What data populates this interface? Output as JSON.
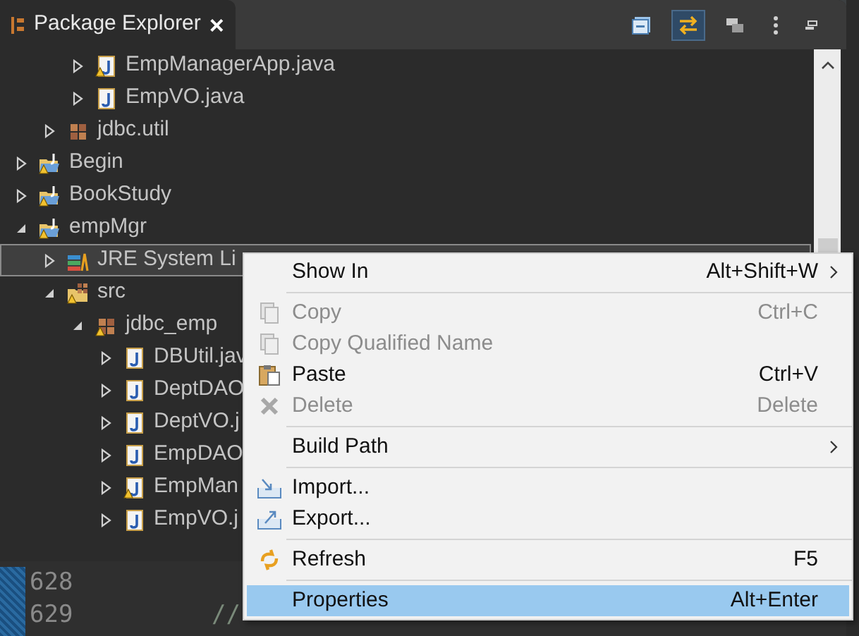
{
  "view_tab": {
    "title": "Package Explorer",
    "close": "×"
  },
  "toolbar": [
    {
      "selected": false
    },
    {
      "selected": true
    },
    {
      "selected": false
    },
    {
      "selected": false
    },
    {
      "selected": false
    }
  ],
  "tree": [
    {
      "children": [
        {
          "children": [
            {
              "kind": "java",
              "label": "EmpManagerApp.java",
              "warning": true,
              "expanded": false,
              "selected": false
            },
            {
              "kind": "java",
              "label": "EmpVO.java",
              "warning": false,
              "expanded": false,
              "selected": false
            }
          ]
        },
        {
          "kind": "package",
          "label": "jdbc.util",
          "warning": false,
          "expanded": false,
          "selected": false
        }
      ]
    },
    {
      "kind": "project",
      "label": "Begin",
      "warning": true,
      "expanded": false,
      "selected": false
    },
    {
      "kind": "project",
      "label": "BookStudy",
      "warning": true,
      "expanded": false,
      "selected": false
    },
    {
      "kind": "project",
      "label": "empMgr",
      "warning": true,
      "expanded": true,
      "selected": false,
      "children": [
        {
          "kind": "library",
          "label": "JRE System Li",
          "warning": false,
          "expanded": false,
          "selected": true
        },
        {
          "kind": "source",
          "label": "src",
          "warning": true,
          "expanded": true,
          "selected": false,
          "children": [
            {
              "kind": "package",
              "label": "jdbc_emp",
              "warning": true,
              "expanded": true,
              "selected": false,
              "children": [
                {
                  "kind": "java",
                  "label": "DBUtil.jav",
                  "warning": false,
                  "expanded": false,
                  "selected": false
                },
                {
                  "kind": "java",
                  "label": "DeptDAO",
                  "warning": false,
                  "expanded": false,
                  "selected": false
                },
                {
                  "kind": "java",
                  "label": "DeptVO.j",
                  "warning": false,
                  "expanded": false,
                  "selected": false
                },
                {
                  "kind": "java",
                  "label": "EmpDAO",
                  "warning": false,
                  "expanded": false,
                  "selected": false
                },
                {
                  "kind": "java",
                  "label": "EmpMan",
                  "warning": true,
                  "expanded": false,
                  "selected": false
                },
                {
                  "kind": "java",
                  "label": "EmpVO.j",
                  "warning": false,
                  "expanded": false,
                  "selected": false
                }
              ]
            }
          ]
        }
      ]
    }
  ],
  "editor": {
    "lines": [
      {
        "number": "628"
      },
      {
        "number": "629",
        "code": "//"
      }
    ]
  },
  "context_menu": [
    {
      "kind": "item",
      "label": "Show In",
      "shortcut": "Alt+Shift+W",
      "submenu": true,
      "disabled": false,
      "selected": false
    },
    {
      "kind": "separator"
    },
    {
      "kind": "item",
      "label": "Copy",
      "shortcut": "Ctrl+C",
      "submenu": false,
      "disabled": true,
      "selected": false
    },
    {
      "kind": "item",
      "label": "Copy Qualified Name",
      "submenu": false,
      "disabled": true,
      "selected": false
    },
    {
      "kind": "item",
      "label": "Paste",
      "shortcut": "Ctrl+V",
      "submenu": false,
      "disabled": false,
      "selected": false
    },
    {
      "kind": "item",
      "label": "Delete",
      "shortcut": "Delete",
      "submenu": false,
      "disabled": true,
      "selected": false
    },
    {
      "kind": "separator"
    },
    {
      "kind": "item",
      "label": "Build Path",
      "submenu": true,
      "disabled": false,
      "selected": false
    },
    {
      "kind": "separator"
    },
    {
      "kind": "item",
      "label": "Import...",
      "submenu": false,
      "disabled": false,
      "selected": false
    },
    {
      "kind": "item",
      "label": "Export...",
      "submenu": false,
      "disabled": false,
      "selected": false
    },
    {
      "kind": "separator"
    },
    {
      "kind": "item",
      "label": "Refresh",
      "shortcut": "F5",
      "submenu": false,
      "disabled": false,
      "selected": false
    },
    {
      "kind": "separator"
    },
    {
      "kind": "item",
      "label": "Properties",
      "shortcut": "Alt+Enter",
      "submenu": false,
      "disabled": false,
      "selected": true
    }
  ]
}
